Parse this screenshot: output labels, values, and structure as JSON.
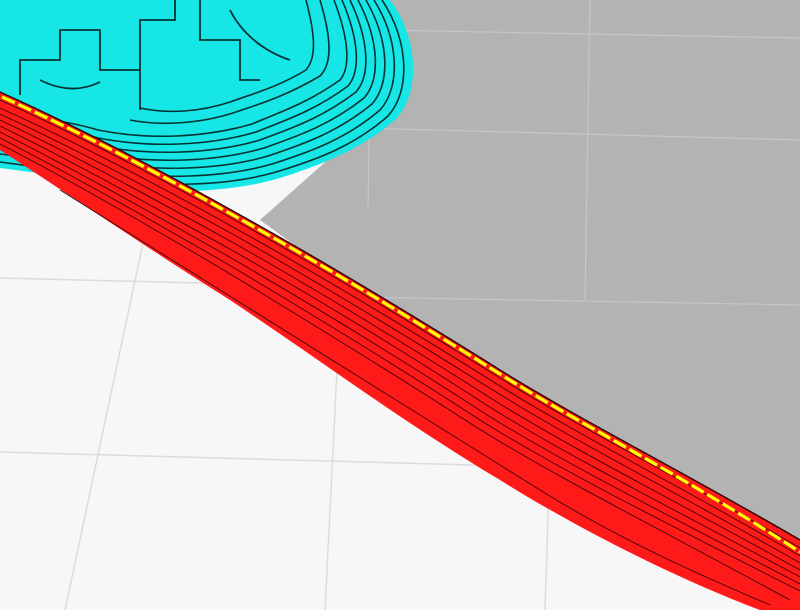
{
  "viewport": {
    "label": "",
    "background_color": "#f7f7f7"
  },
  "build_plate": {
    "grid": true,
    "plate_color": "#f7f7f7",
    "grid_color": "#dcdcdc",
    "shadow_color": "#b3b3b3"
  },
  "layers": {
    "wall": {
      "color": "#ff1a1a",
      "line_color": "#1a0000",
      "seam_color": "#ffff00"
    },
    "support": {
      "color": "#16e6e6",
      "line_color": "#033333"
    }
  }
}
